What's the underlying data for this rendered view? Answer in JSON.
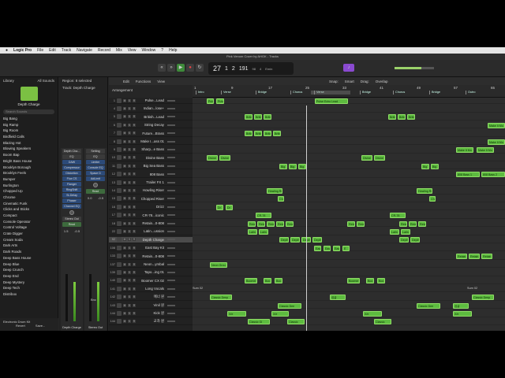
{
  "menubar": {
    "apple": "",
    "app": "Logic Pro",
    "items": [
      "File",
      "Edit",
      "Track",
      "Navigate",
      "Record",
      "Mix",
      "View",
      "Window",
      "?",
      "Help"
    ]
  },
  "window_title": "Pink Venom Cover by AHGK - Tracks",
  "lcd": {
    "bars": "27",
    "beat": "1",
    "div": "2",
    "ticks": "191",
    "tempo": "98",
    "sig": "4",
    "key": "Emin"
  },
  "library": {
    "title": "Library",
    "filter": "All Sounds",
    "patch": "Depth Charge",
    "search_placeholder": "Search Sounds",
    "patches": [
      "Big Bang",
      "Big Ramp",
      "Big Room",
      "Birdfield Calls",
      "Blazing Hot",
      "Blowing Speakers",
      "Boom Bap",
      "Bright Bass House",
      "Brooklyn Borough",
      "Brooklyn Feels",
      "Bumper",
      "Burlington",
      "Chopped Up",
      "Chrome",
      "Cinematic Funk",
      "Clicks and Sticks",
      "Compact",
      "Console Operator",
      "Control Voltage",
      "Crate Digger",
      "Cream Soda",
      "Dark Arts",
      "Dark Roads",
      "Deep Bass House",
      "Deep Blue",
      "Deep Crunch",
      "Deep End",
      "Deep Mystery",
      "Deep Tech",
      "Distribox",
      "Electronic Drum Kit"
    ],
    "foot_revert": "Revert",
    "foot_save": "Save..."
  },
  "inspector": {
    "region_label": "Region:",
    "region_value": "8 selected",
    "track_label": "Track:",
    "track_value": "Depth Charge",
    "strip1": {
      "name": "Depth Charge",
      "slots": [
        "Depth Cha...",
        "EQ",
        "DAW",
        "Compressor",
        "Distortion",
        "Flux CS",
        "Flanger",
        "RingShift",
        "St-Delay",
        "Phaser",
        "Channel EQ"
      ],
      "out": "Stereo Out",
      "mode": "Read",
      "vals": [
        "1.5",
        "-0.5"
      ]
    },
    "strip2": {
      "name": "Stereo Out",
      "slots": [
        "Setting",
        "EQ",
        "Limiter",
        "Console EQ",
        "Space D",
        "AdLimit"
      ],
      "mode": "Read",
      "vals": [
        "0.0",
        "-0.5"
      ],
      "bnc": "Bnc"
    }
  },
  "main_toolbar": [
    "Edit",
    "Functions",
    "View"
  ],
  "snap": "Snap:",
  "snap_val": "Smart",
  "drag": "Drag:",
  "drag_val": "Overlap",
  "arrangement": "Arrangement",
  "ruler": {
    "numbers": [
      "1",
      "9",
      "17",
      "25",
      "33",
      "41",
      "49",
      "57",
      "65"
    ],
    "markers": [
      "Intro",
      "Verse",
      "Bridge",
      "Chorus",
      "Verse",
      "Bridge",
      "Chorus",
      "Bridge",
      "Outro"
    ]
  },
  "tracks": [
    {
      "n": "1",
      "name": "Pulse...Lead"
    },
    {
      "n": "4",
      "name": "Indian...lose+"
    },
    {
      "n": "5",
      "name": "British...Lead"
    },
    {
      "n": "6",
      "name": "String Decay"
    },
    {
      "n": "7",
      "name": "Future...Brass"
    },
    {
      "n": "8",
      "name": "Make I...ass 01"
    },
    {
      "n": "9",
      "name": "Sharp...e Bass"
    },
    {
      "n": "10",
      "name": "Divine Bass"
    },
    {
      "n": "11",
      "name": "Big Sea Bass"
    },
    {
      "n": "12",
      "name": "808 Bass"
    },
    {
      "n": "13",
      "name": "Trailer FX 1"
    },
    {
      "n": "14",
      "name": "Howling Riser"
    },
    {
      "n": "15",
      "name": "Chopped Riser"
    },
    {
      "n": "16",
      "name": "Drizz"
    },
    {
      "n": "17",
      "name": "CR-78...iconic"
    },
    {
      "n": "18",
      "name": "Retain...0-808"
    },
    {
      "n": "22",
      "name": "Latin...ussion"
    },
    {
      "n": "92",
      "name": "Depth Charge"
    },
    {
      "n": "108",
      "name": "East Bay Kit"
    },
    {
      "n": "133",
      "name": "Retain...0-808"
    },
    {
      "n": "137",
      "name": "Neon...ymbal"
    },
    {
      "n": "139",
      "name": "Tapo...ing 01"
    },
    {
      "n": "140",
      "name": "Boomer CX 02"
    },
    {
      "n": "141",
      "name": "Long Vocals"
    },
    {
      "n": "142",
      "name": "에너 원"
    },
    {
      "n": "143",
      "name": "Vinil 원"
    },
    {
      "n": "144",
      "name": "Kick 원"
    },
    {
      "n": "144",
      "name": "교차 원"
    }
  ],
  "regions": [
    {
      "l": 0,
      "s": 18,
      "w": 9,
      "t": "Pulse"
    },
    {
      "l": 0,
      "s": 30,
      "w": 10,
      "t": "Pulse"
    },
    {
      "l": 0,
      "s": 155,
      "w": 42,
      "t": "Pulse Echo Lead"
    },
    {
      "l": 4,
      "s": 66,
      "w": 10,
      "t": "Britis"
    },
    {
      "l": 4,
      "s": 78,
      "w": 10,
      "t": "Britis"
    },
    {
      "l": 4,
      "s": 90,
      "w": 10,
      "t": "Britis"
    },
    {
      "l": 4,
      "s": 102,
      "w": 10,
      "t": "Britis"
    },
    {
      "l": 2,
      "s": 66,
      "w": 10,
      "t": "Britis"
    },
    {
      "l": 2,
      "s": 78,
      "w": 10,
      "t": "Britis"
    },
    {
      "l": 2,
      "s": 90,
      "w": 10,
      "t": "Britis"
    },
    {
      "l": 2,
      "s": 248,
      "w": 10,
      "t": "Britis"
    },
    {
      "l": 2,
      "s": 260,
      "w": 10,
      "t": "Britis"
    },
    {
      "l": 2,
      "s": 272,
      "w": 10,
      "t": "Britis"
    },
    {
      "l": 3,
      "s": 374,
      "w": 22,
      "t": "Make It Mu"
    },
    {
      "l": 5,
      "s": 374,
      "w": 22,
      "t": "Make It Mu"
    },
    {
      "l": 6,
      "s": 334,
      "w": 22,
      "t": "Make It Mu"
    },
    {
      "l": 6,
      "s": 360,
      "w": 22,
      "t": "Make It Mu"
    },
    {
      "l": 7,
      "s": 18,
      "w": 14,
      "t": "Divine"
    },
    {
      "l": 7,
      "s": 34,
      "w": 14,
      "t": "Divine"
    },
    {
      "l": 7,
      "s": 214,
      "w": 14,
      "t": "Divine"
    },
    {
      "l": 7,
      "s": 230,
      "w": 14,
      "t": "Divine"
    },
    {
      "l": 8,
      "s": 110,
      "w": 10,
      "t": "Big"
    },
    {
      "l": 8,
      "s": 122,
      "w": 10,
      "t": "Big"
    },
    {
      "l": 8,
      "s": 134,
      "w": 10,
      "t": "Big"
    },
    {
      "l": 8,
      "s": 290,
      "w": 10,
      "t": "Big"
    },
    {
      "l": 8,
      "s": 302,
      "w": 10,
      "t": "Big"
    },
    {
      "l": 9,
      "s": 334,
      "w": 30,
      "t": "808 Bass 1"
    },
    {
      "l": 9,
      "s": 366,
      "w": 30,
      "t": "808 Bass 2"
    },
    {
      "l": 11,
      "s": 94,
      "w": 20,
      "t": "Howling Ri"
    },
    {
      "l": 11,
      "s": 284,
      "w": 20,
      "t": "Howling Ri"
    },
    {
      "l": 12,
      "s": 108,
      "w": 8,
      "t": "Cho"
    },
    {
      "l": 12,
      "s": 300,
      "w": 8,
      "t": "Cho"
    },
    {
      "l": 13,
      "s": 30,
      "w": 9,
      "t": "Dr"
    },
    {
      "l": 13,
      "s": 42,
      "w": 9,
      "t": "Dr"
    },
    {
      "l": 14,
      "s": 80,
      "w": 20,
      "t": "CR-78"
    },
    {
      "l": 14,
      "s": 250,
      "w": 20,
      "t": "CR-78"
    },
    {
      "l": 15,
      "s": 70,
      "w": 10,
      "t": "Retain"
    },
    {
      "l": 15,
      "s": 82,
      "w": 10,
      "t": "Retain"
    },
    {
      "l": 15,
      "s": 94,
      "w": 10,
      "t": "Retain"
    },
    {
      "l": 15,
      "s": 106,
      "w": 10,
      "t": "Retain"
    },
    {
      "l": 15,
      "s": 118,
      "w": 10,
      "t": "Retain"
    },
    {
      "l": 15,
      "s": 196,
      "w": 10,
      "t": "Retain"
    },
    {
      "l": 15,
      "s": 208,
      "w": 10,
      "t": "Retain"
    },
    {
      "l": 15,
      "s": 262,
      "w": 10,
      "t": "Retain"
    },
    {
      "l": 15,
      "s": 274,
      "w": 10,
      "t": "Retain"
    },
    {
      "l": 15,
      "s": 286,
      "w": 10,
      "t": "Retain"
    },
    {
      "l": 16,
      "s": 70,
      "w": 12,
      "t": "Latin"
    },
    {
      "l": 16,
      "s": 84,
      "w": 12,
      "t": "Latin"
    },
    {
      "l": 16,
      "s": 250,
      "w": 12,
      "t": "Latin"
    },
    {
      "l": 16,
      "s": 264,
      "w": 12,
      "t": "Latin"
    },
    {
      "l": 17,
      "s": 110,
      "w": 12,
      "t": "Depth"
    },
    {
      "l": 17,
      "s": 124,
      "w": 12,
      "t": "Depth"
    },
    {
      "l": 17,
      "s": 138,
      "w": 12,
      "t": "Depth"
    },
    {
      "l": 17,
      "s": 152,
      "w": 12,
      "t": "Depth"
    },
    {
      "l": 17,
      "s": 262,
      "w": 12,
      "t": "Depth"
    },
    {
      "l": 17,
      "s": 276,
      "w": 12,
      "t": "Depth"
    },
    {
      "l": 18,
      "s": 154,
      "w": 9,
      "t": "East"
    },
    {
      "l": 18,
      "s": 166,
      "w": 9,
      "t": "East"
    },
    {
      "l": 18,
      "s": 178,
      "w": 9,
      "t": "East"
    },
    {
      "l": 18,
      "s": 190,
      "w": 9,
      "t": "E"
    },
    {
      "l": 19,
      "s": 334,
      "w": 14,
      "t": "Retain"
    },
    {
      "l": 19,
      "s": 350,
      "w": 14,
      "t": "Retain"
    },
    {
      "l": 19,
      "s": 366,
      "w": 14,
      "t": "Retain"
    },
    {
      "l": 20,
      "s": 22,
      "w": 22,
      "t": "Neon Grou"
    },
    {
      "l": 22,
      "s": 66,
      "w": 16,
      "t": "Boomer"
    },
    {
      "l": 22,
      "s": 90,
      "w": 10,
      "t": "Boo"
    },
    {
      "l": 22,
      "s": 104,
      "w": 10,
      "t": "Boo"
    },
    {
      "l": 22,
      "s": 196,
      "w": 16,
      "t": "Boomer"
    },
    {
      "l": 22,
      "s": 220,
      "w": 10,
      "t": "Boo"
    },
    {
      "l": 22,
      "s": 234,
      "w": 10,
      "t": "Boo"
    },
    {
      "l": 24,
      "s": 22,
      "w": 28,
      "t": "Classic Deep"
    },
    {
      "l": 24,
      "s": 174,
      "w": 20,
      "t": "싱글"
    },
    {
      "l": 24,
      "s": 354,
      "w": 28,
      "t": "Classic Deep"
    },
    {
      "l": 25,
      "s": 108,
      "w": 30,
      "t": "Classic Dee"
    },
    {
      "l": 25,
      "s": 284,
      "w": 30,
      "t": "Classic Dee"
    },
    {
      "l": 25,
      "s": 330,
      "w": 20,
      "t": "싱글"
    },
    {
      "l": 26,
      "s": 44,
      "w": 24,
      "t": "X/e"
    },
    {
      "l": 26,
      "s": 100,
      "w": 22,
      "t": "X/e"
    },
    {
      "l": 26,
      "s": 216,
      "w": 24,
      "t": "X/e"
    },
    {
      "l": 26,
      "s": 330,
      "w": 24,
      "t": "X/e"
    },
    {
      "l": 27,
      "s": 70,
      "w": 28,
      "t": "Classic Gl"
    },
    {
      "l": 27,
      "s": 120,
      "w": 22,
      "t": "Classic"
    },
    {
      "l": 27,
      "s": 230,
      "w": 22,
      "t": "Classic"
    }
  ],
  "lane_labels": [
    {
      "l": 23,
      "s": 0,
      "t": "Sum 02"
    },
    {
      "l": 23,
      "s": 348,
      "t": "Sum 02"
    }
  ],
  "colors": {
    "region": "#5dbb3f",
    "selected_track": "#4b4b4b",
    "accent": "#3a5a85"
  }
}
